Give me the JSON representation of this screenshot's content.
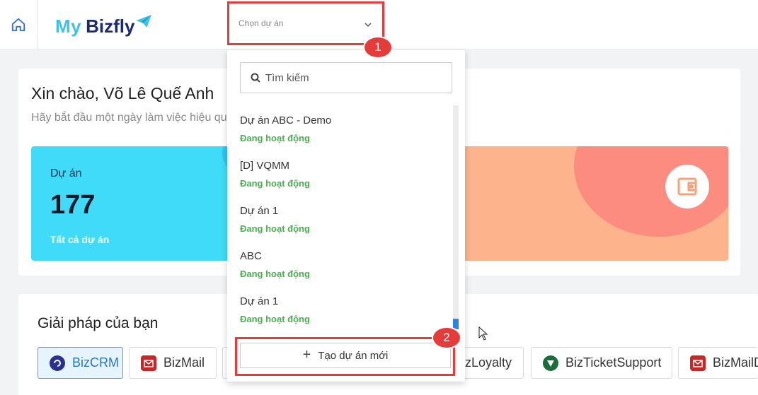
{
  "header": {
    "logo_my": "My",
    "logo_bizfly": "Bizfly",
    "project_placeholder": "Chọn dự án"
  },
  "annotations": {
    "step1": "1",
    "step2": "2"
  },
  "welcome": {
    "greeting": "Xin chào, Võ Lê Quế Anh",
    "subtitle": "Hãy bắt đầu một ngày làm việc hiệu quả"
  },
  "stats": {
    "projects_label": "Dự án",
    "projects_value": "177",
    "projects_link": "Tất cả dự án"
  },
  "solutions": {
    "title": "Giải pháp của bạn",
    "chips": [
      "BizCRM",
      "BizMail",
      "BizLoyalty",
      "BizTicketSupport",
      "BizMailD"
    ]
  },
  "dropdown": {
    "search_placeholder": "Tìm kiếm",
    "items": [
      {
        "name": "Dự án ABC - Demo",
        "status": "Đang hoạt động"
      },
      {
        "name": "[D] VQMM",
        "status": "Đang hoạt động"
      },
      {
        "name": "Dự án 1",
        "status": "Đang hoạt động"
      },
      {
        "name": "ABC",
        "status": "Đang hoạt động"
      },
      {
        "name": "Dự án 1",
        "status": "Đang hoạt động"
      }
    ],
    "create_label": "Tạo dự án mới"
  },
  "colors": {
    "accent_red": "#e53b3b",
    "status_green": "#4caf50",
    "stat_blue": "#3fdbf9",
    "stat_orange": "#fdb48d"
  },
  "icons": [
    "home-icon",
    "paper-plane-icon",
    "chevron-down-icon",
    "search-icon",
    "wallet-icon",
    "plus-icon",
    "cursor-icon"
  ]
}
